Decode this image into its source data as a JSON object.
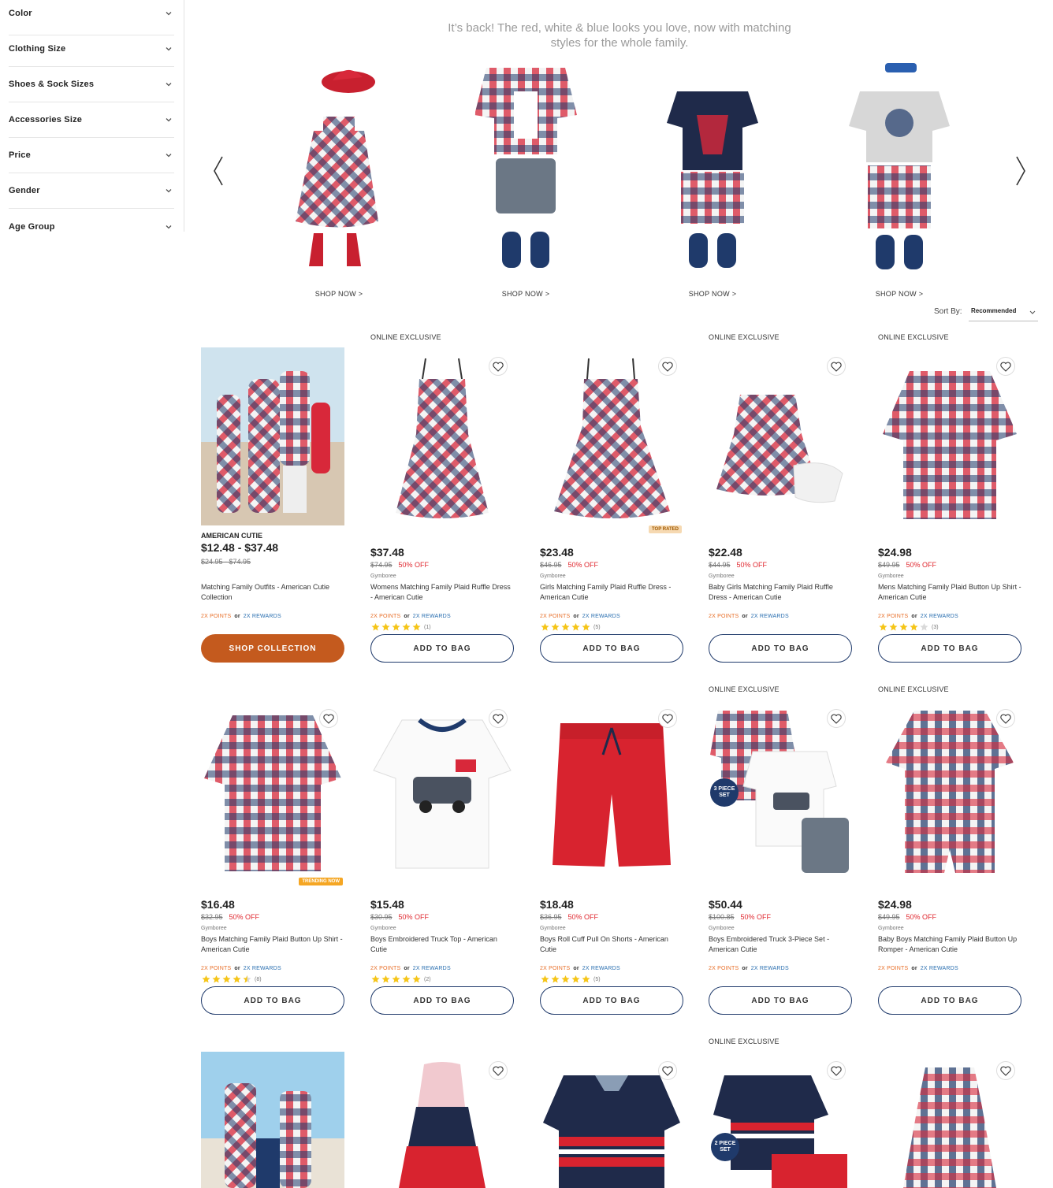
{
  "sidebar": {
    "filters": [
      {
        "label": "Color"
      },
      {
        "label": "Clothing Size"
      },
      {
        "label": "Shoes & Sock Sizes"
      },
      {
        "label": "Accessories Size"
      },
      {
        "label": "Price"
      },
      {
        "label": "Gender"
      },
      {
        "label": "Age Group"
      }
    ]
  },
  "hero": {
    "tagline": "It’s back! The red, white & blue looks you love, now with matching styles for the whole family.",
    "shop_now": [
      "SHOP NOW >",
      "SHOP NOW >",
      "SHOP NOW >",
      "SHOP NOW >"
    ]
  },
  "sort": {
    "label": "Sort By:",
    "value": "Recommended"
  },
  "common": {
    "online_exclusive": "ONLINE EXCLUSIVE",
    "add_to_bag": "ADD TO BAG",
    "brand": "Gymboree",
    "points": "2X POINTS",
    "or": "or",
    "rewards": "2X REWARDS",
    "top_rated": "TOP RATED",
    "trending_now": "TRENDING NOW"
  },
  "collection": {
    "title": "AMERICAN CUTIE",
    "price": "$12.48 - $37.48",
    "was": "$24.95 - $74.95",
    "name": "Matching Family Outfits - American Cutie Collection",
    "button": "SHOP COLLECTION"
  },
  "products": [
    {
      "price": "$37.48",
      "was": "$74.95",
      "off": "50% OFF",
      "name": "Womens Matching Family Plaid Ruffle Dress - American Cutie",
      "rating": 5,
      "count": "(1)"
    },
    {
      "price": "$23.48",
      "was": "$46.95",
      "off": "50% OFF",
      "name": "Girls Matching Family Plaid Ruffle Dress - American Cutie",
      "rating": 5,
      "count": "(5)"
    },
    {
      "price": "$22.48",
      "was": "$44.95",
      "off": "50% OFF",
      "name": "Baby Girls Matching Family Plaid Ruffle Dress - American Cutie"
    },
    {
      "price": "$24.98",
      "was": "$49.95",
      "off": "50% OFF",
      "name": "Mens Matching Family Plaid Button Up Shirt - American Cutie",
      "rating": 4,
      "count": "(3)"
    },
    {
      "price": "$16.48",
      "was": "$32.95",
      "off": "50% OFF",
      "name": "Boys Matching Family Plaid Button Up Shirt - American Cutie",
      "rating": 4.5,
      "count": "(8)"
    },
    {
      "price": "$15.48",
      "was": "$30.95",
      "off": "50% OFF",
      "name": "Boys Embroidered Truck Top - American Cutie",
      "rating": 5,
      "count": "(2)"
    },
    {
      "price": "$18.48",
      "was": "$36.95",
      "off": "50% OFF",
      "name": "Boys Roll Cuff Pull On Shorts - American Cutie",
      "rating": 5,
      "count": "(5)"
    },
    {
      "price": "$50.44",
      "was": "$100.85",
      "off": "50% OFF",
      "name": "Boys Embroidered Truck 3-Piece Set - American Cutie"
    },
    {
      "price": "$24.98",
      "was": "$49.95",
      "off": "50% OFF",
      "name": "Baby Boys Matching Family Plaid Button Up Romper - American Cutie"
    }
  ],
  "set_badges": {
    "three": "3 PIECE SET",
    "two": "2 PIECE SET"
  },
  "colors": {
    "accent": "#c45a1e",
    "navy": "#1f3a6b",
    "red": "#d8283a",
    "sale": "#e0282f",
    "star": "#f5c518"
  }
}
